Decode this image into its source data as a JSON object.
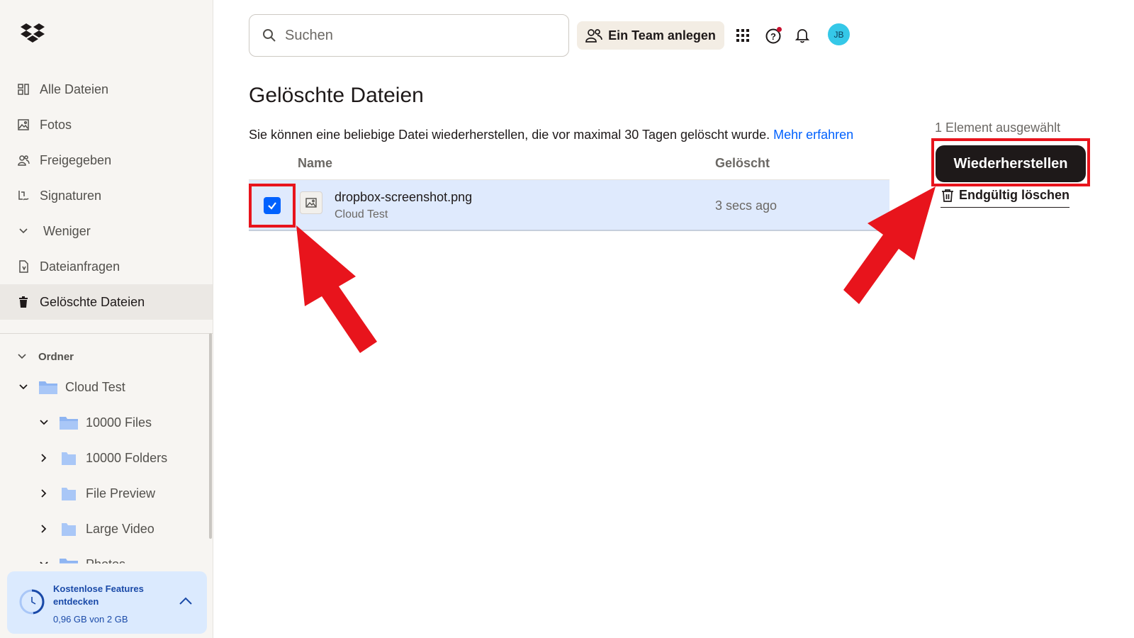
{
  "sidebar": {
    "logo_icon": "dropbox-logo-icon",
    "nav_items": [
      {
        "label": "Alle Dateien",
        "icon": "all-files-icon"
      },
      {
        "label": "Fotos",
        "icon": "photos-icon"
      },
      {
        "label": "Freigegeben",
        "icon": "shared-icon"
      },
      {
        "label": "Signaturen",
        "icon": "signatures-icon"
      },
      {
        "label": "Weniger",
        "icon": "chevron-down-icon"
      },
      {
        "label": "Dateianfragen",
        "icon": "file-requests-icon"
      },
      {
        "label": "Gelöschte Dateien",
        "icon": "trash-icon",
        "active": true
      }
    ],
    "tree_heading": "Ordner",
    "tree_items": [
      {
        "label": "Cloud Test",
        "expanded": true,
        "level": 0
      },
      {
        "label": "10000 Files",
        "expanded": true,
        "level": 1
      },
      {
        "label": "10000 Folders",
        "expanded": false,
        "level": 1
      },
      {
        "label": "File Preview",
        "expanded": false,
        "level": 1
      },
      {
        "label": "Large Video",
        "expanded": false,
        "level": 1
      },
      {
        "label": "Photos",
        "expanded": true,
        "level": 1
      }
    ],
    "promo": {
      "title": "Kostenlose Features entdecken",
      "storage": "0,96 GB von 2 GB",
      "storage_used_fraction": 0.48
    }
  },
  "topbar": {
    "search_placeholder": "Suchen",
    "team_button": "Ein Team anlegen",
    "apps_icon": "apps-grid-icon",
    "help_icon": "help-icon",
    "notifications_icon": "bell-icon",
    "avatar_initials": "JB"
  },
  "main": {
    "title": "Gelöschte Dateien",
    "info_text": "Sie können eine beliebige Datei wiederherstellen, die vor maximal 30 Tagen gelöscht wurde.",
    "info_link": "Mehr erfahren",
    "columns": {
      "name": "Name",
      "deleted": "Gelöscht"
    },
    "rows": [
      {
        "name": "dropbox-screenshot.png",
        "folder": "Cloud Test",
        "deleted": "3 secs ago",
        "selected": true
      }
    ]
  },
  "actions": {
    "selection_count": "1 Element ausgewählt",
    "restore_button": "Wiederherstellen",
    "delete_link": "Endgültig löschen"
  },
  "colors": {
    "accent": "#0061fe",
    "annotation": "#e8141c",
    "selected_row": "#dfeafd",
    "sidebar_bg": "#f7f5f2",
    "primary_button": "#1e1919"
  }
}
